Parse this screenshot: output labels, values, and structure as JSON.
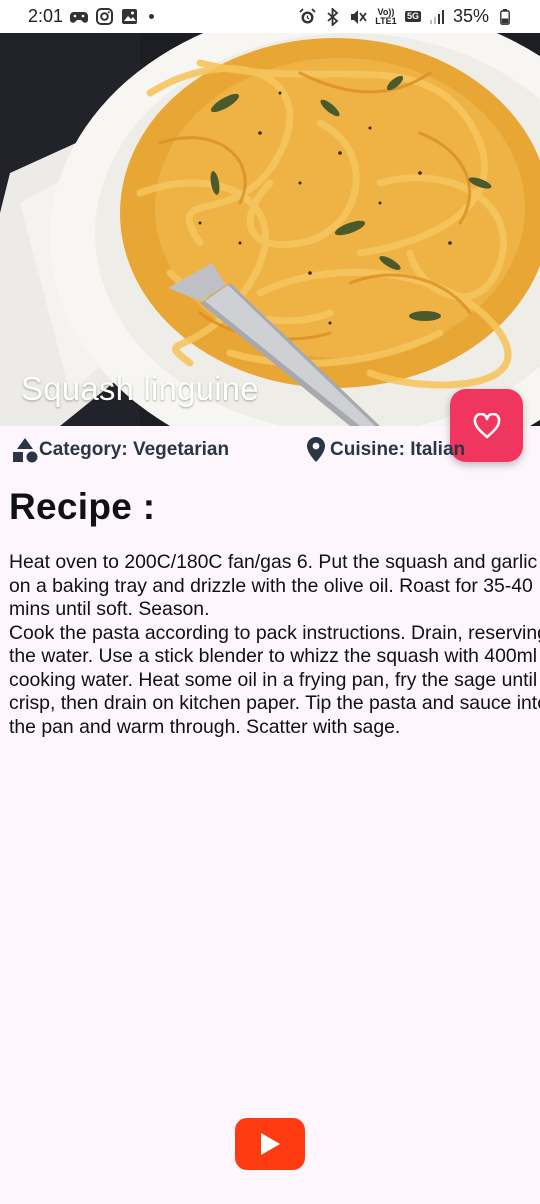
{
  "status_bar": {
    "time": "2:01",
    "battery": "35%",
    "network": "5G",
    "volte": "Vo)) LTE1"
  },
  "hero": {
    "title": "Squash linguine"
  },
  "favorite_button": {
    "icon": "heart-outline-icon"
  },
  "meta": {
    "category": "Category: Vegetarian",
    "cuisine": "Cuisine: Italian"
  },
  "recipe": {
    "heading": "Recipe :",
    "instructions": "Heat oven to 200C/180C fan/gas 6. Put the squash and garlic on a baking tray and drizzle with the olive oil. Roast for 35-40 mins until soft. Season.\nCook the pasta according to pack instructions. Drain, reserving the water. Use a stick blender to whizz the squash with 400ml cooking water. Heat some oil in a frying pan, fry the sage until crisp, then drain on kitchen paper. Tip the pasta and sauce into the pan and warm through. Scatter with sage."
  },
  "youtube_button": {
    "icon": "youtube-play-icon"
  },
  "colors": {
    "accent": "#f0355f",
    "youtube": "#ff3b12",
    "meta_text": "#2a3646",
    "background": "#fdf7fd"
  }
}
